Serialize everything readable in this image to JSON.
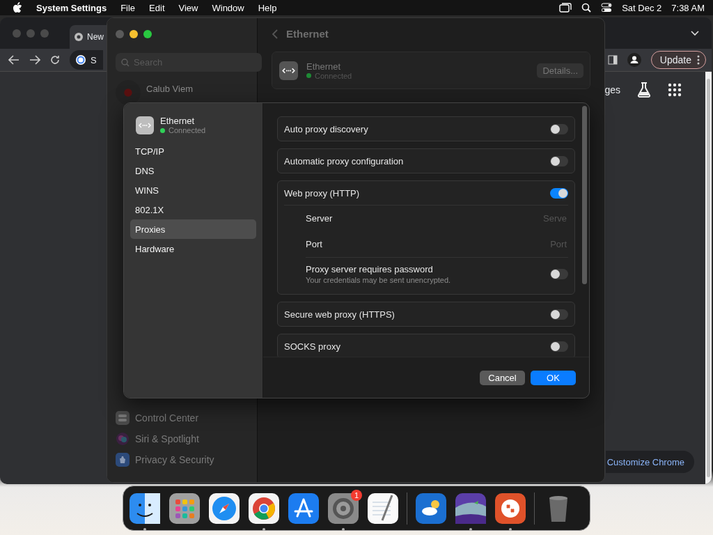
{
  "menu_bar": {
    "app": "System Settings",
    "menus": [
      "File",
      "Edit",
      "View",
      "Window",
      "Help"
    ],
    "date": "Sat Dec 2",
    "time": "7:38 AM"
  },
  "browser": {
    "tab": "New",
    "address": "S",
    "update_button": "Update",
    "shortcut_label": "ges",
    "customize_button": "Customize Chrome"
  },
  "settings": {
    "search": {
      "placeholder": "Search"
    },
    "account": {
      "name": "Calub Viem"
    },
    "sidebar_items": [
      {
        "kind": "control",
        "label": "Control Center"
      },
      {
        "kind": "siri",
        "label": "Siri & Spotlight"
      },
      {
        "kind": "privacy",
        "label": "Privacy & Security"
      }
    ],
    "title": "Ethernet",
    "interface": {
      "name": "Ethernet",
      "status": "Connected",
      "button": "Details..."
    }
  },
  "dialog": {
    "interface": {
      "name": "Ethernet",
      "status": "Connected"
    },
    "tabs": [
      {
        "label": "TCP/IP",
        "selected": false
      },
      {
        "label": "DNS",
        "selected": false
      },
      {
        "label": "WINS",
        "selected": false
      },
      {
        "label": "802.1X",
        "selected": false
      },
      {
        "label": "Proxies",
        "selected": true
      },
      {
        "label": "Hardware",
        "selected": false
      }
    ],
    "rows": [
      {
        "kind": "toggle",
        "label": "Auto proxy discovery",
        "on": false
      },
      {
        "kind": "toggle",
        "label": "Automatic proxy configuration",
        "on": false
      },
      {
        "kind": "group",
        "label": "Web proxy (HTTP)",
        "on": true,
        "children": [
          {
            "kind": "field",
            "label": "Server",
            "placeholder": "Serve"
          },
          {
            "kind": "field",
            "label": "Port",
            "placeholder": "Port"
          },
          {
            "kind": "toggle",
            "label": "Proxy server requires password",
            "note": "Your credentials may be sent unencrypted.",
            "on": false
          }
        ]
      },
      {
        "kind": "toggle",
        "label": "Secure web proxy (HTTPS)",
        "on": false
      },
      {
        "kind": "toggle",
        "label": "SOCKS proxy",
        "on": false
      }
    ],
    "buttons": [
      {
        "kind": "secondary",
        "label": "Cancel"
      },
      {
        "kind": "primary",
        "label": "OK"
      }
    ]
  },
  "dock": {
    "apps": [
      {
        "kind": "finder",
        "running": true
      },
      {
        "kind": "launchpad"
      },
      {
        "kind": "safari"
      },
      {
        "kind": "chrome",
        "running": true
      },
      {
        "kind": "appstore"
      },
      {
        "kind": "settings",
        "running": true,
        "badge": "1"
      },
      {
        "kind": "textedit"
      }
    ],
    "recent_apps": [
      {
        "kind": "weather"
      },
      {
        "kind": "landscape",
        "running": true
      },
      {
        "kind": "remote",
        "running": true
      }
    ]
  }
}
